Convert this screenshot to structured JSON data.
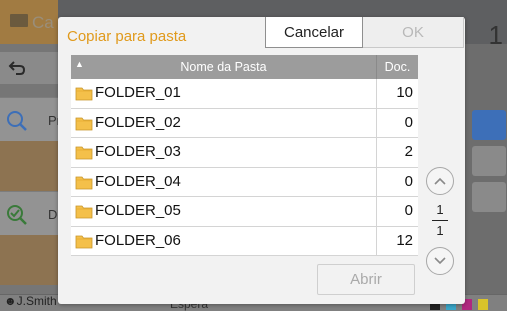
{
  "background": {
    "tab_label": "Ca",
    "page_number": "1",
    "left_buttons": [
      {
        "label": "Pr",
        "icon": "search-icon"
      },
      {
        "label": "De",
        "icon": "search-check-icon"
      }
    ],
    "footer": {
      "user": "J.Smith",
      "status": "Espera",
      "ink_labels": [
        "K",
        "C",
        "M",
        "Y"
      ]
    }
  },
  "dialog": {
    "title": "Copiar para pasta",
    "cancel_label": "Cancelar",
    "ok_label": "OK",
    "open_label": "Abrir",
    "columns": {
      "name": "Nome da Pasta",
      "count": "Doc."
    },
    "folders": [
      {
        "name": "FOLDER_01",
        "count": "10"
      },
      {
        "name": "FOLDER_02",
        "count": "0"
      },
      {
        "name": "FOLDER_03",
        "count": "2"
      },
      {
        "name": "FOLDER_04",
        "count": "0"
      },
      {
        "name": "FOLDER_05",
        "count": "0"
      },
      {
        "name": "FOLDER_06",
        "count": "12"
      }
    ],
    "pager": {
      "current": "1",
      "total": "1"
    }
  },
  "colors": {
    "title_accent": "#e09a1c",
    "folder_icon": "#f4c04a",
    "header_gray": "#9c9c9c"
  }
}
